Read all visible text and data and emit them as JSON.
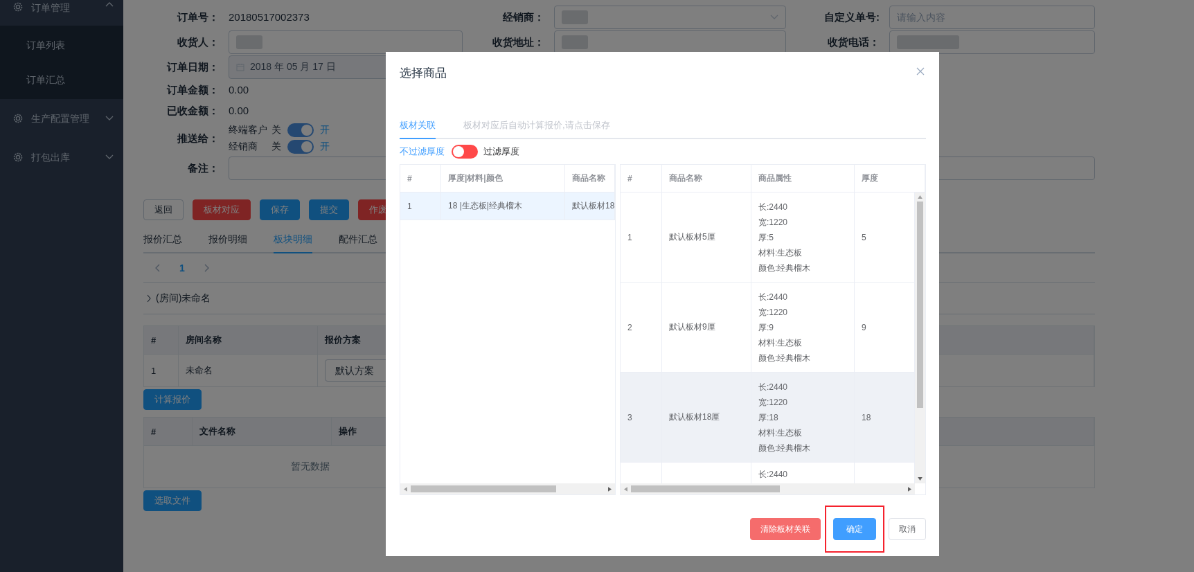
{
  "sidebar": {
    "items": [
      {
        "label": "订单管理",
        "expanded": true,
        "children": [
          {
            "label": "订单列表"
          },
          {
            "label": "订单汇总"
          }
        ]
      },
      {
        "label": "生产配置管理",
        "expanded": false
      },
      {
        "label": "打包出库",
        "expanded": false
      }
    ]
  },
  "order_form": {
    "order_no": {
      "label": "订单号：",
      "value": "20180517002373"
    },
    "dealer": {
      "label": "经销商：",
      "redacted": true
    },
    "custom_no": {
      "label": "自定义单号:",
      "placeholder": "请输入内容"
    },
    "receiver": {
      "label": "收货人：",
      "redacted": true
    },
    "address": {
      "label": "收货地址：",
      "redacted": true
    },
    "phone": {
      "label": "收货电话：",
      "redacted": true
    },
    "order_date": {
      "label": "订单日期：",
      "value": "2018 年 05 月 17 日"
    },
    "amount": {
      "label": "订单金额：",
      "value": "0.00"
    },
    "received": {
      "label": "已收金额：",
      "value": "0.00"
    },
    "push_to": {
      "label": "推送给：",
      "switches": [
        {
          "name": "终端客户",
          "off_label": "关",
          "on_label": "开",
          "on": true
        },
        {
          "name": "经销商",
          "off_label": "关",
          "on_label": "开",
          "on": true
        }
      ]
    },
    "remark": {
      "label": "备注："
    }
  },
  "actions": [
    {
      "label": "返回",
      "kind": "default"
    },
    {
      "label": "板材对应",
      "kind": "danger"
    },
    {
      "label": "保存",
      "kind": "primary"
    },
    {
      "label": "提交",
      "kind": "primary"
    },
    {
      "label": "作废",
      "kind": "danger"
    }
  ],
  "tabs": [
    {
      "label": "报价汇总",
      "selected": false
    },
    {
      "label": "报价明细",
      "selected": false
    },
    {
      "label": "板块明细",
      "selected": true
    },
    {
      "label": "配件汇总",
      "selected": false
    }
  ],
  "pagination": {
    "pages": [
      {
        "label": "1",
        "selected": true
      }
    ]
  },
  "room_group": {
    "title": "(房间)未命名",
    "expanded": false
  },
  "room_table": {
    "columns": [
      "#",
      "房间名称",
      "报价方案"
    ],
    "rows": [
      {
        "index": "1",
        "name": "未命名",
        "plan": "默认方案"
      }
    ]
  },
  "calc_button": "计算报价",
  "file_table": {
    "columns": [
      "#",
      "文件名称",
      "操作"
    ],
    "empty_text": "暂无数据"
  },
  "upload_button": "选取文件",
  "dialog": {
    "title": "选择商品",
    "tabs": [
      {
        "label": "板材关联",
        "selected": true,
        "disabled": false
      },
      {
        "label": "板材对应后自动计算报价,请点击保存",
        "selected": false,
        "disabled": true
      }
    ],
    "filter": {
      "off_label": "不过滤厚度",
      "on_label": "过滤厚度",
      "on": false
    },
    "left_table": {
      "columns": [
        "#",
        "厚度|材料|颜色",
        "商品名称"
      ],
      "rows": [
        {
          "index": "1",
          "spec": "18 |生态板|经典榴木",
          "name": "默认板材18",
          "selected": true
        }
      ]
    },
    "right_table": {
      "columns": [
        "#",
        "商品名称",
        "商品属性",
        "厚度"
      ],
      "rows": [
        {
          "index": "1",
          "name": "默认板材5厘",
          "attributes": [
            "长:2440",
            "宽:1220",
            "厚:5",
            "材料:生态板",
            "颜色:经典榴木"
          ],
          "thickness": "5",
          "highlighted": false
        },
        {
          "index": "2",
          "name": "默认板材9厘",
          "attributes": [
            "长:2440",
            "宽:1220",
            "厚:9",
            "材料:生态板",
            "颜色:经典榴木"
          ],
          "thickness": "9",
          "highlighted": false
        },
        {
          "index": "3",
          "name": "默认板材18厘",
          "attributes": [
            "长:2440",
            "宽:1220",
            "厚:18",
            "材料:生态板",
            "颜色:经典榴木"
          ],
          "thickness": "18",
          "highlighted": true
        },
        {
          "attributes": [
            "长:2440"
          ],
          "highlighted": false
        }
      ]
    },
    "buttons": [
      {
        "label": "清除板材关联",
        "kind": "danger",
        "marked": false
      },
      {
        "label": "确定",
        "kind": "primary",
        "marked": true
      },
      {
        "label": "取消",
        "kind": "default",
        "marked": false
      }
    ]
  }
}
